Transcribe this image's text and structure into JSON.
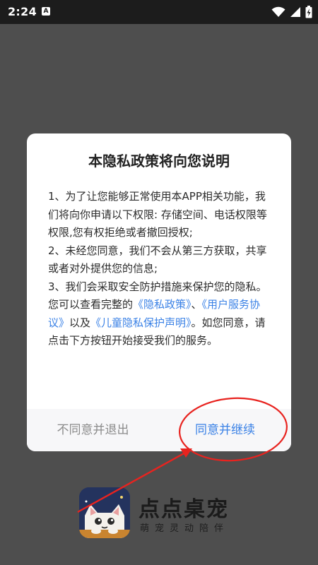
{
  "status_bar": {
    "time": "2:24",
    "notification_badge": "A",
    "icons": [
      "wifi-icon",
      "signal-icon",
      "battery-icon"
    ]
  },
  "dialog": {
    "title": "本隐私政策将向您说明",
    "paragraph_1": "1、为了让您能够正常使用本APP相关功能，我们将向你申请以下权限: 存储空间、电话权限等权限,您有权拒绝或者撤回授权;",
    "paragraph_2": "2、未经您同意，我们不会从第三方获取，共享或者对外提供您的信息;",
    "paragraph_3_prefix": "3、我们会采取安全防护措施来保护您的隐私。 您可以查看完整的",
    "link_privacy_policy": "《隐私政策》",
    "separator_1": "、",
    "link_user_agreement": "《用户服务协议》",
    "separator_2": "以及",
    "link_child_privacy": "《儿童隐私保护声明》",
    "paragraph_3_suffix": "。如您同意，请点击下方按钮开始接受我们的服务。",
    "decline_label": "不同意并退出",
    "accept_label": "同意并继续"
  },
  "brand": {
    "name": "点点桌宠",
    "slogan": "萌宠灵动陪伴"
  },
  "colors": {
    "link": "#3b82e6",
    "annotation": "#e8231f",
    "overlay": "#4e4e4e"
  }
}
